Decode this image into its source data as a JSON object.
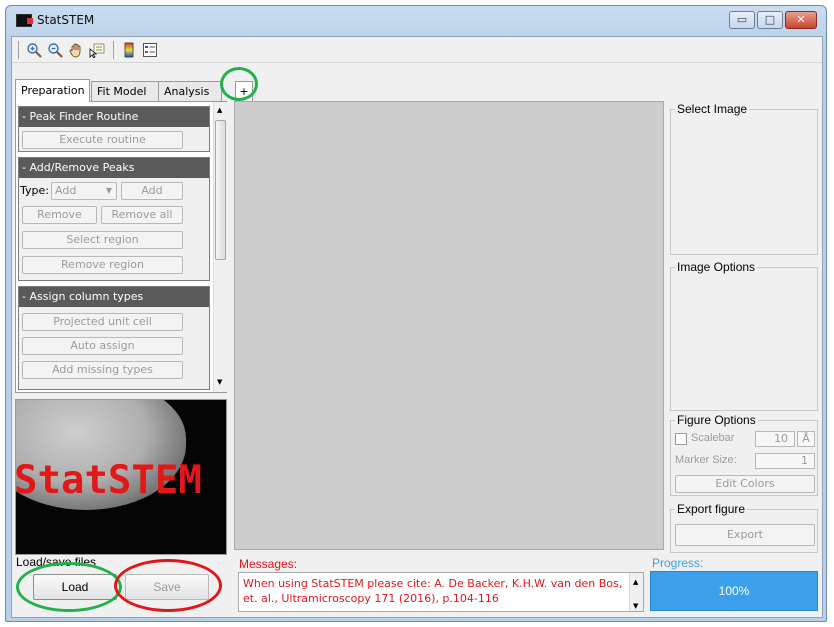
{
  "window": {
    "title": "StatSTEM",
    "minimize": "▭",
    "maximize": "□",
    "close": "✕"
  },
  "toolbar": {
    "icons": [
      "zoom-in-icon",
      "zoom-out-icon",
      "pan-hand-icon",
      "data-cursor-icon",
      "colorbar-icon",
      "legend-icon"
    ]
  },
  "tabs": [
    "Preparation",
    "Fit Model",
    "Analysis",
    "+"
  ],
  "left_panel": {
    "peak_finder": {
      "header": "- Peak Finder Routine",
      "execute": "Execute routine"
    },
    "add_remove": {
      "header": "- Add/Remove Peaks",
      "type_label": "Type:",
      "type_value": "Add",
      "add": "Add",
      "remove": "Remove",
      "remove_all": "Remove all",
      "select_region": "Select region",
      "remove_region": "Remove region"
    },
    "assign": {
      "header": "- Assign column types",
      "projected_unit_cell": "Projected unit cell",
      "auto_assign": "Auto assign",
      "add_missing": "Add missing types"
    }
  },
  "logo": {
    "text": "StatSTEM"
  },
  "right_panel": {
    "select_image": "Select Image",
    "image_options": "Image Options",
    "figure_options": {
      "title": "Figure Options",
      "scalebar_label": "Scalebar",
      "scalebar_value": "10",
      "unit": "Å",
      "marker_label": "Marker Size:",
      "marker_value": "1",
      "edit_colors": "Edit Colors"
    },
    "export": {
      "title": "Export figure",
      "button": "Export"
    }
  },
  "bottom": {
    "load_save_label": "Load/save files",
    "load": "Load",
    "save": "Save",
    "messages_label": "Messages:",
    "message_text": "When using StatSTEM please cite: A. De Backer, K.H.W. van den Bos, et. al., Ultramicroscopy 171 (2016), p.104-116",
    "progress_label": "Progress:",
    "progress_value": "100%",
    "progress_fraction": 1.0
  },
  "colors": {
    "accent_ring": "#22b14c",
    "alert_ring": "#e01818",
    "progress": "#3ca0ec",
    "message_text": "#e01818"
  }
}
